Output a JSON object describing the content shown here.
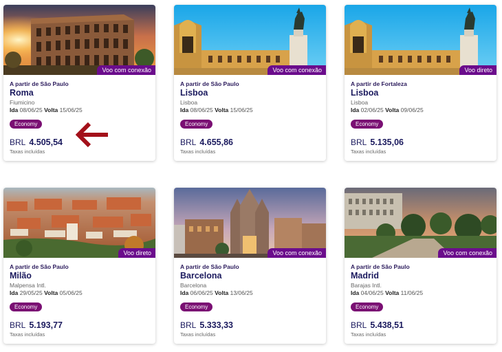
{
  "labels": {
    "ida": "Ida",
    "volta": "Volta",
    "taxes": "Taxas incluídas"
  },
  "colors": {
    "badge": "#6b0c8c",
    "cabin": "#7a0f73",
    "title": "#1b1a5e",
    "arrow": "#a3101a"
  },
  "cards": [
    {
      "origin": "A partir de São Paulo",
      "city": "Roma",
      "airport": "Fiumicino",
      "depart": "08/06/25",
      "return": "15/06/25",
      "cabin": "Economy",
      "currency": "BRL",
      "price": "4.505,54",
      "flight_type": "Voo com conexão",
      "image": "colosseum-sunset"
    },
    {
      "origin": "A partir de São Paulo",
      "city": "Lisboa",
      "airport": "Lisboa",
      "depart": "08/06/25",
      "return": "15/06/25",
      "cabin": "Economy",
      "currency": "BRL",
      "price": "4.655,86",
      "flight_type": "Voo com conexão",
      "image": "lisbon-praca-do-comercio"
    },
    {
      "origin": "A partir de Fortaleza",
      "city": "Lisboa",
      "airport": "Lisboa",
      "depart": "02/06/25",
      "return": "09/06/25",
      "cabin": "Economy",
      "currency": "BRL",
      "price": "5.135,06",
      "flight_type": "Voo direto",
      "image": "lisbon-praca-do-comercio"
    },
    {
      "origin": "A partir de São Paulo",
      "city": "Milão",
      "airport": "Malpensa Intl.",
      "depart": "29/05/25",
      "return": "05/06/25",
      "cabin": "Economy",
      "currency": "BRL",
      "price": "5.193,77",
      "flight_type": "Voo direto",
      "image": "milan-aerial"
    },
    {
      "origin": "A partir de São Paulo",
      "city": "Barcelona",
      "airport": "Barcelona",
      "depart": "06/06/25",
      "return": "13/06/25",
      "cabin": "Economy",
      "currency": "BRL",
      "price": "5.333,33",
      "flight_type": "Voo com conexão",
      "image": "barcelona-cathedral"
    },
    {
      "origin": "A partir de São Paulo",
      "city": "Madrid",
      "airport": "Barajas Intl.",
      "depart": "04/06/25",
      "return": "11/06/25",
      "cabin": "Economy",
      "currency": "BRL",
      "price": "5.438,51",
      "flight_type": "Voo com conexão",
      "image": "madrid-royal-palace"
    }
  ]
}
